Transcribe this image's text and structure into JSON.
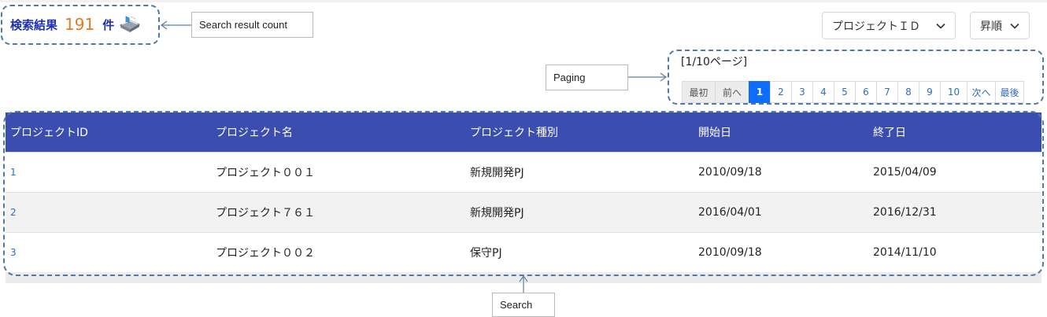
{
  "result_count": {
    "prefix": "検索結果",
    "count": "191",
    "suffix": "件",
    "icon": "book-icon",
    "annotation": "Search result count"
  },
  "sort": {
    "field": "プロジェクトＩＤ",
    "order": "昇順"
  },
  "paging": {
    "info": "[1/10ページ]",
    "first": "最初",
    "prev": "前へ",
    "pages": [
      "1",
      "2",
      "3",
      "4",
      "5",
      "6",
      "7",
      "8",
      "9",
      "10"
    ],
    "current": "1",
    "next": "次へ",
    "last": "最後",
    "annotation": "Paging"
  },
  "table": {
    "columns": [
      "プロジェクトID",
      "プロジェクト名",
      "プロジェクト種別",
      "開始日",
      "終了日"
    ],
    "rows": [
      [
        "1",
        "プロジェクト００１",
        "新規開発PJ",
        "2010/09/18",
        "2015/04/09"
      ],
      [
        "2",
        "プロジェクト７６１",
        "新規開発PJ",
        "2016/04/01",
        "2016/12/31"
      ],
      [
        "3",
        "プロジェクト００２",
        "保守PJ",
        "2010/09/18",
        "2014/11/10"
      ]
    ],
    "annotation": "Search"
  },
  "colors": {
    "header_bg": "#3b4daf",
    "accent_count": "#e07a26",
    "label_blue": "#1e2fb5",
    "active_page": "#0d6efd",
    "callout_border": "#4f7aa8"
  }
}
